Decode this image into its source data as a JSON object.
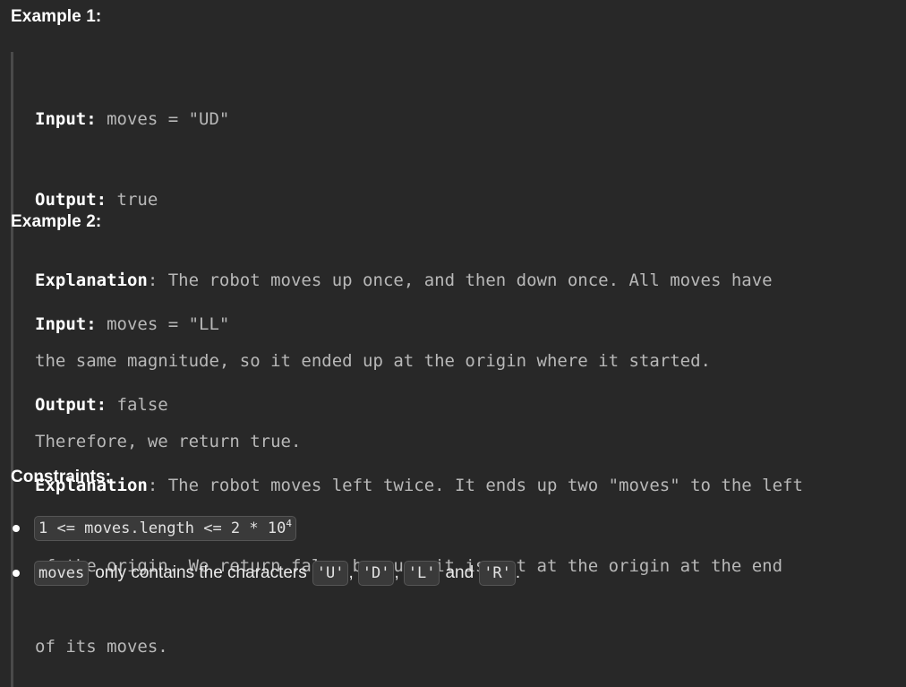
{
  "example1": {
    "heading": "Example 1:",
    "input_label": "Input:",
    "input_value": " moves = \"UD\"",
    "output_label": "Output:",
    "output_value": " true",
    "explanation_label": "Explanation",
    "explanation_lines": [
      ": The robot moves up once, and then down once. All moves have",
      "the same magnitude, so it ended up at the origin where it started.",
      "Therefore, we return true."
    ]
  },
  "example2": {
    "heading": "Example 2:",
    "input_label": "Input:",
    "input_value": " moves = \"LL\"",
    "output_label": "Output:",
    "output_value": " false",
    "explanation_label": "Explanation",
    "explanation_lines": [
      ": The robot moves left twice. It ends up two \"moves\" to the left",
      "of the origin. We return false because it is not at the origin at the end",
      "of its moves."
    ]
  },
  "constraints": {
    "heading": "Constraints:",
    "item1": {
      "code_base": "1 <= moves.length <= 2 * 10",
      "code_exp": "4"
    },
    "item2": {
      "code_moves": "moves",
      "text_only": "only contains the characters",
      "code_u": "'U'",
      "sep1": ",",
      "code_d": "'D'",
      "sep2": ",",
      "code_l": "'L'",
      "text_and": "and",
      "code_r": "'R'",
      "end": "."
    }
  }
}
